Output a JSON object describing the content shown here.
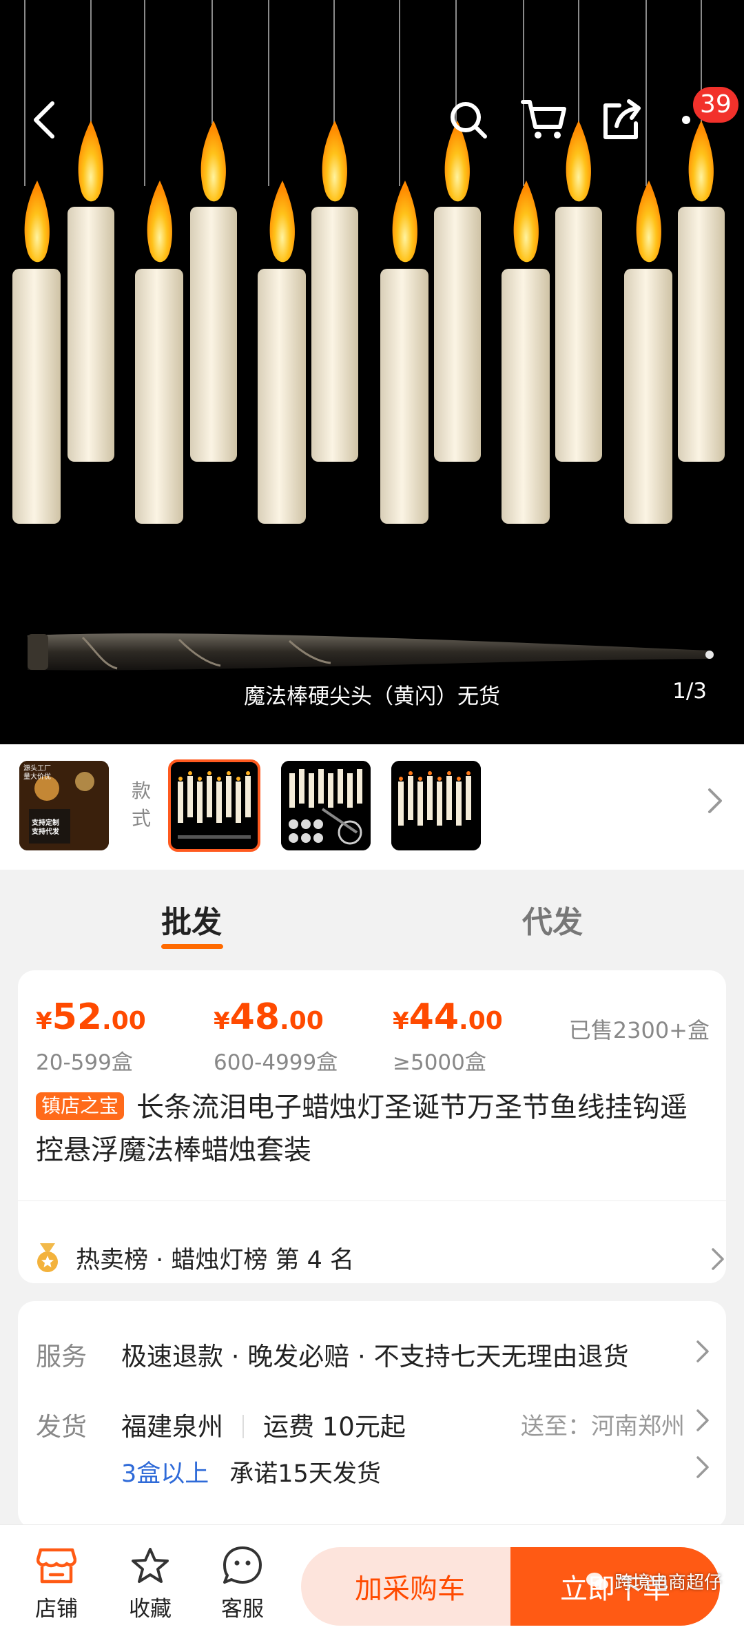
{
  "hero": {
    "caption": "魔法棒硬尖头（黄闪）无货",
    "counter": "1/3",
    "cart_badge": "39"
  },
  "variants": {
    "label_1": "款",
    "label_2": "式",
    "thumb1_text_1": "源头工厂",
    "thumb1_text_2": "量大价优",
    "thumb1_text_3": "支持定制",
    "thumb1_text_4": "支持代发"
  },
  "tabs": {
    "wholesale": "批发",
    "dropship": "代发"
  },
  "pricing": {
    "tiers": [
      {
        "yen": "¥",
        "int": "52",
        "dec": ".00",
        "qty": "20-599盒"
      },
      {
        "yen": "¥",
        "int": "48",
        "dec": ".00",
        "qty": "600-4999盒"
      },
      {
        "yen": "¥",
        "int": "44",
        "dec": ".00",
        "qty": "≥5000盒"
      }
    ],
    "sold": "已售2300+盒",
    "shop_tag": "镇店之宝",
    "title": "长条流泪电子蜡烛灯圣诞节万圣节鱼线挂钩遥控悬浮魔法棒蜡烛套装",
    "rank_text": "热卖榜 · 蜡烛灯榜 第 4 名"
  },
  "service": {
    "service_label": "服务",
    "service_text": "极速退款 · 晚发必赔 · 不支持七天无理由退货",
    "ship_label": "发货",
    "origin": "福建泉州",
    "freight": "运费 10元起",
    "deliver_to": "送至：河南郑州",
    "promise_qty": "3盒以上",
    "promise_text": "承诺15天发货"
  },
  "bottom": {
    "store": "店铺",
    "favorite": "收藏",
    "service": "客服",
    "add_cart": "加采购车",
    "buy_now": "立即下单",
    "watermark": "跨境电商超仔"
  },
  "colors": {
    "accent": "#ff5a14",
    "price": "#ff4a00",
    "link_blue": "#2e6ad8",
    "badge_red": "#f2312b"
  }
}
